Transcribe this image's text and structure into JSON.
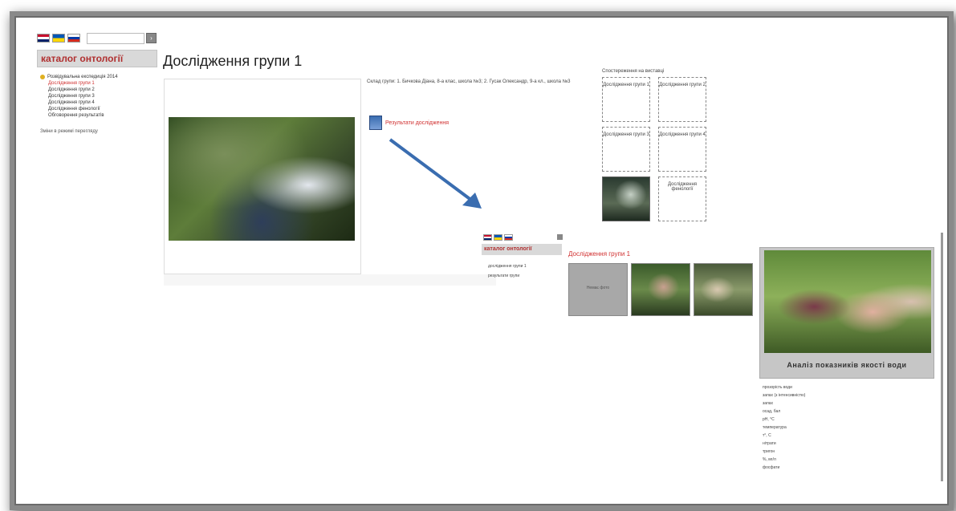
{
  "left_page": {
    "catalog_title": "каталог онтології",
    "menu_group": "Розвідувальна експедиція 2014",
    "menu_items": [
      "Дослідження групи 1",
      "Дослідження групи 2",
      "Дослідження групи 3",
      "Дослідження групи 4",
      "Дослідження фенології",
      "Обговорення результатів"
    ],
    "menu_after": "Зміни в режимі перегляду",
    "page_title": "Дослідження групи 1",
    "composition": "Склад групи: 1. Бичкова Діана, 8-а клас, школа №3; 2. Гусак Олександр, 9-а кл., школа №3",
    "results_link": "Результати дослідження"
  },
  "groups_panel": {
    "title": "Спостереження на виставці",
    "cells": [
      "Дослідження групи 1",
      "Дослідження групи 2",
      "Дослідження групи 3",
      "Дослідження групи 4",
      "",
      "Дослідження фенології"
    ]
  },
  "second_screen": {
    "catalog_title": "каталог онтології",
    "menu": [
      "дослідження групи 1",
      "результати групи"
    ],
    "title": "Дослідження групи 1",
    "thumb_label": "Немає фото",
    "big_caption": "Аналіз показників якості води",
    "list": [
      "прозорість води",
      "запах (з інтенсивністю)",
      "запах",
      "осад, бал",
      "рН, °С",
      "температура",
      "т°, С",
      "нітрати",
      "тригон",
      "%, мг/л",
      "фосфати"
    ]
  },
  "colors": {
    "accent": "#d03030",
    "catalog_bar": "#d9d9d9",
    "arrow": "#3a6db0"
  }
}
